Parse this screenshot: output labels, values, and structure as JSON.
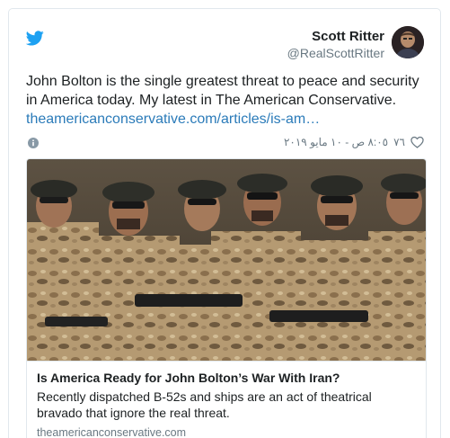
{
  "author": {
    "name": "Scott Ritter",
    "handle": "@RealScottRitter"
  },
  "tweet": {
    "text": "John Bolton is the single greatest threat to peace and security in America today. My latest in The American Conservative.",
    "link": "theamericanconservative.com/articles/is-am…",
    "likes": "٧٦",
    "datetime": "٨:٠٥ ص - ١٠ مايو ٢٠١٩"
  },
  "link_card": {
    "title": "Is America Ready for John Bolton’s War With Iran?",
    "description": "Recently dispatched B-52s and ships are an act of theatrical bravado that ignore the real threat.",
    "domain": "theamericanconservative.com"
  },
  "colors": {
    "twitter_blue": "#1da1f2",
    "link_blue": "#2b7bb9",
    "secondary_text": "#697882",
    "border": "#e1e8ed"
  },
  "icons": {
    "logo": "twitter-bird-icon",
    "info": "info-icon",
    "like": "heart-icon"
  }
}
